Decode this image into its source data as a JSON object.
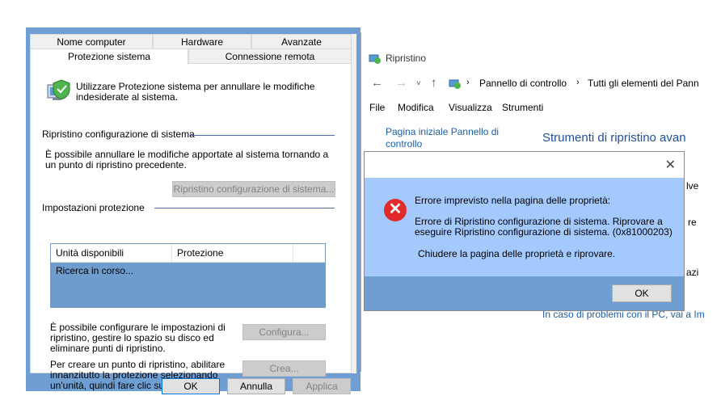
{
  "sysprops": {
    "tabs_row1": [
      "Nome computer",
      "Hardware",
      "Avanzate"
    ],
    "tabs_row2": [
      "Protezione sistema",
      "Connessione remota"
    ],
    "intro": "Utilizzare Protezione sistema per annullare le modifiche indesiderate al sistema.",
    "restore_group": "Ripristino configurazione di sistema",
    "restore_desc": "È possibile annullare le modifiche apportate al sistema tornando a un punto di ripristino precedente.",
    "restore_button": "Ripristino configurazione di sistema...",
    "protection_group": "Impostazioni protezione",
    "list_columns": [
      "Unità disponibili",
      "Protezione"
    ],
    "list_status": "Ricerca in corso...",
    "configure_desc": "È possibile configurare le impostazioni di ripristino, gestire lo spazio su disco ed eliminare punti di ripristino.",
    "configure_button": "Configura...",
    "create_desc": "Per creare un punto di ripristino, abilitare innanzitutto la protezione selezionando un'unità, quindi fare clic su Configura.",
    "create_button": "Crea...",
    "ok_button": "OK",
    "cancel_button": "Annulla",
    "apply_button": "Applica"
  },
  "control_panel": {
    "title": "Ripristino",
    "breadcrumb": [
      "Pannello di controllo",
      "Tutti gli elementi del Pann"
    ],
    "menu": [
      "File",
      "Modifica",
      "Visualizza",
      "Strumenti"
    ],
    "side_link": "Pagina iniziale Pannello di controllo",
    "heading": "Strumenti di ripristino avan",
    "bottom_link": "In caso di problemi con il PC, vai a Im",
    "partial_1": "lve",
    "partial_2": "re",
    "partial_3": "azi"
  },
  "error_dialog": {
    "title_line": "Errore imprevisto nella pagina delle proprietà:",
    "message": "Errore di Ripristino configurazione di sistema. Riprovare a eseguire Ripristino configurazione di sistema. (0x81000203)",
    "hint": "Chiudere la pagina delle proprietà e riprovare.",
    "ok_button": "OK"
  }
}
